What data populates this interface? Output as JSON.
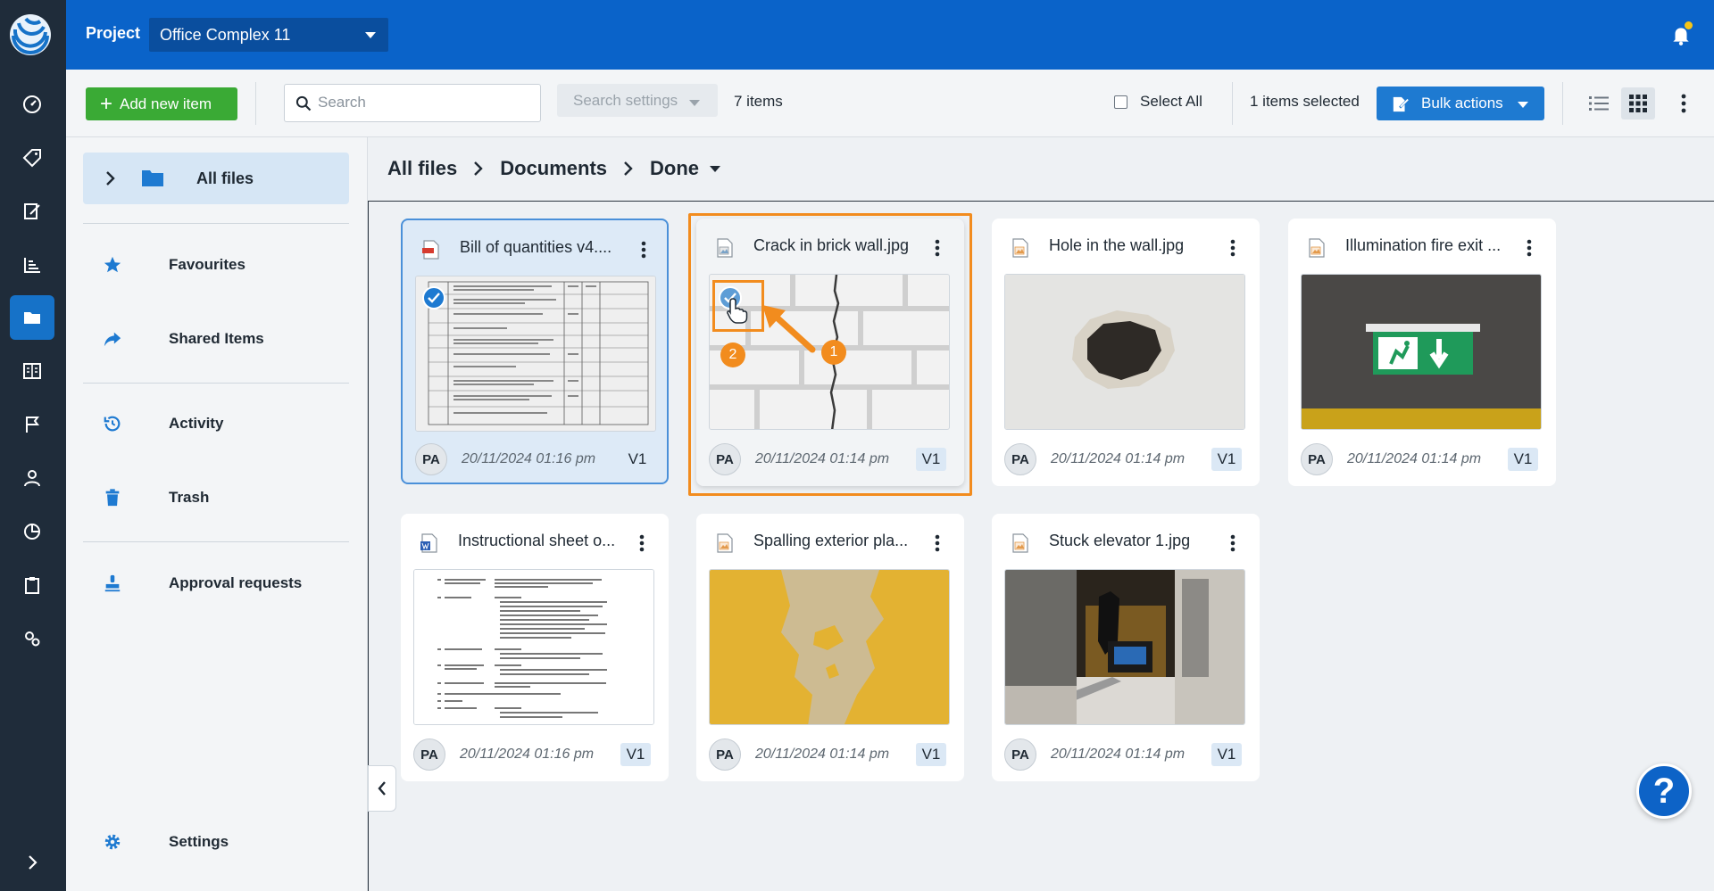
{
  "header": {
    "project_label": "Project",
    "project_value": "Office Complex 11"
  },
  "toolbar": {
    "add_label": "Add new item",
    "search_placeholder": "Search",
    "search_settings_label": "Search settings",
    "items_count": "7 items",
    "select_all_label": "Select All",
    "selected_count": "1 items selected",
    "bulk_label": "Bulk actions"
  },
  "sidebar": {
    "all_files": "All files",
    "items": [
      {
        "label": "Favourites",
        "icon": "star-icon"
      },
      {
        "label": "Shared Items",
        "icon": "share-icon"
      },
      {
        "label": "Activity",
        "icon": "history-icon"
      },
      {
        "label": "Trash",
        "icon": "trash-icon"
      },
      {
        "label": "Approval requests",
        "icon": "stamp-icon"
      },
      {
        "label": "Settings",
        "icon": "gear-icon"
      }
    ]
  },
  "breadcrumb": {
    "items": [
      "All files",
      "Documents",
      "Done"
    ]
  },
  "files": [
    {
      "name": "Bill of quantities v4....",
      "user": "PA",
      "date": "20/11/2024 01:16 pm",
      "version": "V1"
    },
    {
      "name": "Crack in brick wall.jpg",
      "user": "PA",
      "date": "20/11/2024 01:14 pm",
      "version": "V1"
    },
    {
      "name": "Hole in the wall.jpg",
      "user": "PA",
      "date": "20/11/2024 01:14 pm",
      "version": "V1"
    },
    {
      "name": "Illumination fire exit ...",
      "user": "PA",
      "date": "20/11/2024 01:14 pm",
      "version": "V1"
    },
    {
      "name": "Instructional sheet o...",
      "user": "PA",
      "date": "20/11/2024 01:16 pm",
      "version": "V1"
    },
    {
      "name": "Spalling exterior pla...",
      "user": "PA",
      "date": "20/11/2024 01:14 pm",
      "version": "V1"
    },
    {
      "name": "Stuck elevator 1.jpg",
      "user": "PA",
      "date": "20/11/2024 01:14 pm",
      "version": "V1"
    }
  ],
  "annotations": {
    "step1": "1",
    "step2": "2"
  },
  "help_label": "?",
  "colors": {
    "brand_blue": "#0a63c9",
    "rail": "#1f2c3a",
    "add_green": "#3aaa35",
    "annotation_orange": "#f28c1e"
  }
}
